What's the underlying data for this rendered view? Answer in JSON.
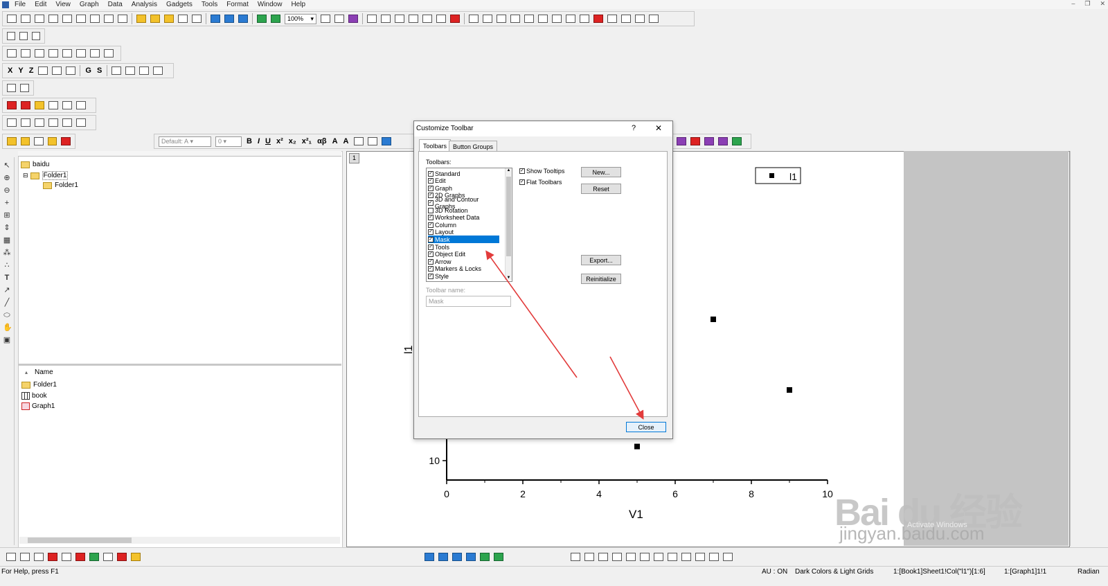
{
  "menu": [
    "File",
    "Edit",
    "View",
    "Graph",
    "Data",
    "Analysis",
    "Gadgets",
    "Tools",
    "Format",
    "Window",
    "Help"
  ],
  "toolbar": {
    "zoom": "100%",
    "font_default": "Default: A",
    "font_size": "0",
    "xyz_labels": [
      "X",
      "Y",
      "Z",
      "G",
      "S"
    ],
    "format_labels": [
      "B",
      "I",
      "U",
      "x²",
      "x₂",
      "x²₁",
      "αβ",
      "A",
      "A"
    ]
  },
  "project_explorer": {
    "root": "baidu",
    "folder": "Folder1",
    "subfolder": "Folder1",
    "list_header": "Name",
    "items": [
      {
        "name": "Folder1",
        "icon": "folder-icon"
      },
      {
        "name": "book",
        "icon": "worksheet-icon"
      },
      {
        "name": "Graph1",
        "icon": "graph-icon"
      }
    ]
  },
  "graph": {
    "page_number": "1",
    "legend_text": "l1",
    "xlabel": "V1",
    "ylabel": "l1",
    "x_ticks": [
      "0",
      "2",
      "4",
      "6",
      "8",
      "10"
    ],
    "y_ticks": [
      "10"
    ]
  },
  "chart_data": {
    "type": "scatter",
    "xlabel": "V1",
    "ylabel": "l1",
    "xlim": [
      0,
      10
    ],
    "x_ticks": [
      0,
      2,
      4,
      6,
      8,
      10
    ],
    "y_ticks_visible": [
      10
    ],
    "legend": [
      "l1"
    ],
    "points_visible": [
      {
        "x": 5,
        "y": 13
      },
      {
        "x": 7,
        "y": 40
      },
      {
        "x": 9,
        "y": 25
      }
    ]
  },
  "dialog": {
    "title": "Customize Toolbar",
    "help": "?",
    "close_x": "✕",
    "tabs": [
      "Toolbars",
      "Button Groups"
    ],
    "toolbars_label": "Toolbars:",
    "toolbars": [
      {
        "name": "Standard",
        "checked": true
      },
      {
        "name": "Edit",
        "checked": true
      },
      {
        "name": "Graph",
        "checked": true
      },
      {
        "name": "2D Graphs",
        "checked": true
      },
      {
        "name": "3D and Contour Graphs",
        "checked": true
      },
      {
        "name": "3D Rotation",
        "checked": false
      },
      {
        "name": "Worksheet Data",
        "checked": true
      },
      {
        "name": "Column",
        "checked": true
      },
      {
        "name": "Layout",
        "checked": true
      },
      {
        "name": "Mask",
        "checked": true,
        "selected": true
      },
      {
        "name": "Tools",
        "checked": true
      },
      {
        "name": "Object Edit",
        "checked": true
      },
      {
        "name": "Arrow",
        "checked": true
      },
      {
        "name": "Markers & Locks",
        "checked": true
      },
      {
        "name": "Style",
        "checked": true
      }
    ],
    "show_tooltips": "Show Tooltips",
    "flat_toolbars": "Flat Toolbars",
    "toolbar_name_label": "Toolbar name:",
    "toolbar_name_value": "Mask",
    "buttons": {
      "new": "New...",
      "reset": "Reset",
      "export": "Export...",
      "reinitialize": "Reinitialize",
      "close": "Close"
    }
  },
  "status": {
    "help": "For Help, press F1",
    "au": "AU : ON",
    "theme": "Dark Colors & Light Grids",
    "cell": "1:[Book1]Sheet1!Col(\"l1\")[1:6]",
    "graph": "1:[Graph1]1!1",
    "angle": "Radian"
  },
  "watermark": {
    "brand": "Bai du 经验",
    "url": "jingyan.baidu.com",
    "activate": "Activate Windows"
  },
  "colors": {
    "arrow": "#e23b3b",
    "selection": "#0078d7"
  }
}
